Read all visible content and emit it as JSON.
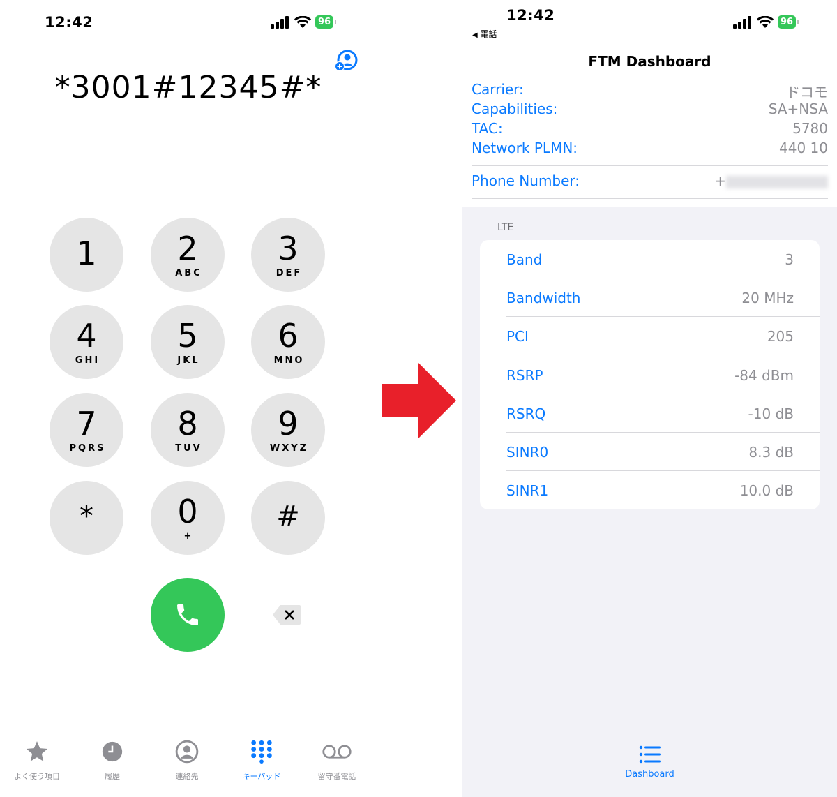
{
  "colors": {
    "accent": "#0a7aff",
    "call_green": "#34c759",
    "arrow_red": "#e8202a",
    "key_gray": "#e5e5e5",
    "label_gray": "#8e8e93"
  },
  "left": {
    "status": {
      "time": "12:42",
      "battery": "96"
    },
    "dialed_number": "*3001#12345#*",
    "keys": [
      {
        "digit": "1",
        "letters": ""
      },
      {
        "digit": "2",
        "letters": "ABC"
      },
      {
        "digit": "3",
        "letters": "DEF"
      },
      {
        "digit": "4",
        "letters": "GHI"
      },
      {
        "digit": "5",
        "letters": "JKL"
      },
      {
        "digit": "6",
        "letters": "MNO"
      },
      {
        "digit": "7",
        "letters": "PQRS"
      },
      {
        "digit": "8",
        "letters": "TUV"
      },
      {
        "digit": "9",
        "letters": "WXYZ"
      },
      {
        "digit": "*",
        "letters": ""
      },
      {
        "digit": "0",
        "letters": "+"
      },
      {
        "digit": "#",
        "letters": ""
      }
    ],
    "tabs": [
      {
        "label": "よく使う項目",
        "icon": "star-icon"
      },
      {
        "label": "履歴",
        "icon": "clock-icon"
      },
      {
        "label": "連絡先",
        "icon": "person-icon"
      },
      {
        "label": "キーパッド",
        "icon": "keypad-icon"
      },
      {
        "label": "留守番電話",
        "icon": "voicemail-icon"
      }
    ]
  },
  "right": {
    "status": {
      "time": "12:42",
      "battery": "96",
      "back_label": "電話"
    },
    "title": "FTM Dashboard",
    "info": [
      {
        "label": "Carrier:",
        "value": "ドコモ"
      },
      {
        "label": "Capabilities:",
        "value": "SA+NSA"
      },
      {
        "label": "TAC:",
        "value": "5780"
      },
      {
        "label": "Network PLMN:",
        "value": "440 10"
      }
    ],
    "phone": {
      "label": "Phone Number:",
      "value_prefix": "+"
    },
    "section": "LTE",
    "lte": [
      {
        "label": "Band",
        "value": "3"
      },
      {
        "label": "Bandwidth",
        "value": "20 MHz"
      },
      {
        "label": "PCI",
        "value": "205"
      },
      {
        "label": "RSRP",
        "value": "-84 dBm"
      },
      {
        "label": "RSRQ",
        "value": "-10 dB"
      },
      {
        "label": "SINR0",
        "value": "8.3 dB"
      },
      {
        "label": "SINR1",
        "value": "10.0 dB"
      }
    ],
    "tab": {
      "label": "Dashboard",
      "icon": "list-icon"
    }
  }
}
